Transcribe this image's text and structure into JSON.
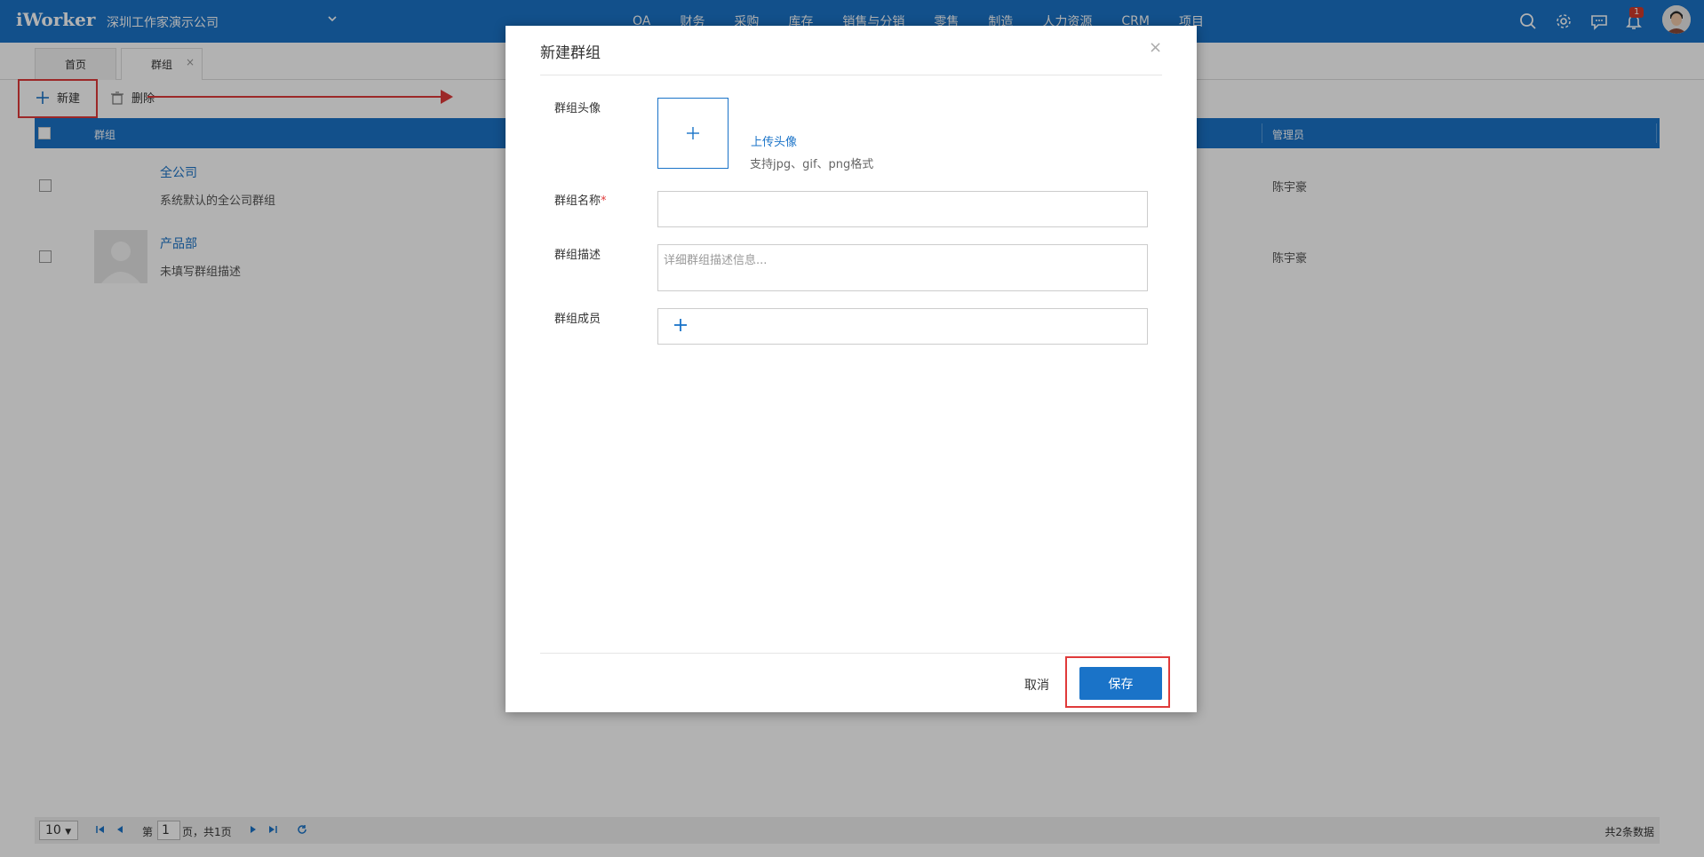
{
  "app": {
    "logo": "iWorker",
    "company": "深圳工作家演示公司"
  },
  "topnav": [
    "OA",
    "财务",
    "采购",
    "库存",
    "销售与分销",
    "零售",
    "制造",
    "人力资源",
    "CRM",
    "项目"
  ],
  "notifications": {
    "badge": "1"
  },
  "tabs": [
    {
      "label": "首页"
    },
    {
      "label": "群组",
      "close": "×"
    }
  ],
  "toolbar": {
    "new_label": "新建",
    "delete_label": "删除"
  },
  "table": {
    "columns": {
      "group": "群组",
      "admin": "管理员"
    },
    "rows": [
      {
        "name": "全公司",
        "desc": "系统默认的全公司群组",
        "admin": "陈宇豪"
      },
      {
        "name": "产品部",
        "desc": "未填写群组描述",
        "admin": "陈宇豪"
      }
    ]
  },
  "pager": {
    "page_size": "10",
    "page_prefix": "第",
    "page_value": "1",
    "page_suffix": "页，共1页",
    "total": "共2条数据"
  },
  "modal": {
    "title": "新建群组",
    "close": "×",
    "avatar_label": "群组头像",
    "upload_link": "上传头像",
    "upload_hint": "支持jpg、gif、png格式",
    "name_label": "群组名称",
    "required_mark": "*",
    "desc_label": "群组描述",
    "desc_placeholder": "详细群组描述信息...",
    "members_label": "群组成员",
    "cancel_label": "取消",
    "save_label": "保存"
  },
  "colors": {
    "primary": "#1a73c8",
    "highlight": "#e03a3a"
  }
}
